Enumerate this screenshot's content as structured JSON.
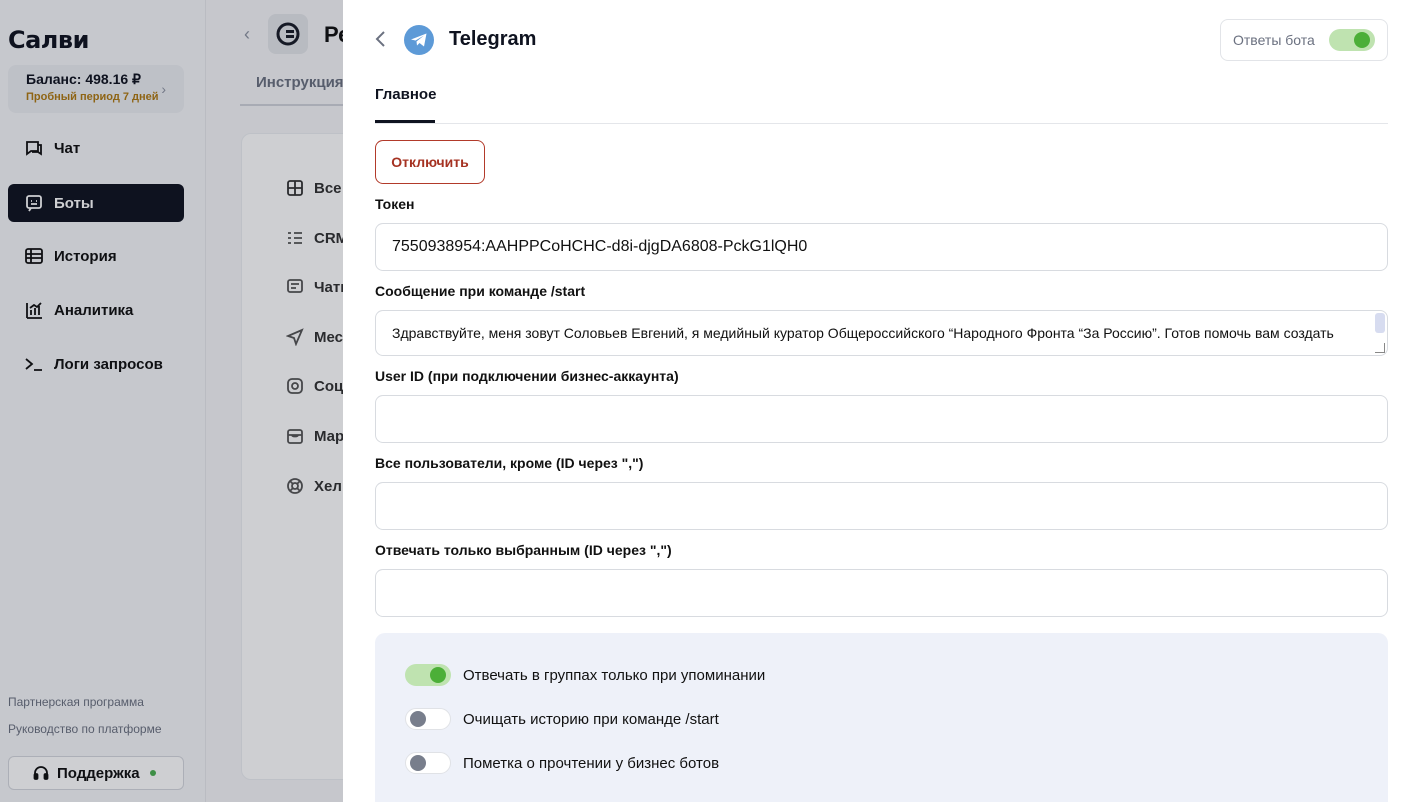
{
  "sidebar": {
    "logo": "Салви",
    "balance": {
      "amount": "Баланс: 498.16 ₽",
      "trial": "Пробный период 7 дней"
    },
    "nav": [
      {
        "label": "Чат",
        "icon": "chat-icon"
      },
      {
        "label": "Боты",
        "icon": "bot-icon",
        "active": true
      },
      {
        "label": "История",
        "icon": "history-icon"
      },
      {
        "label": "Аналитика",
        "icon": "analytics-icon"
      },
      {
        "label": "Логи запросов",
        "icon": "terminal-icon"
      }
    ],
    "footer_links": [
      "Партнерская программа",
      "Руководство по платформе"
    ],
    "support": "Поддержка"
  },
  "middle": {
    "title": "Ре",
    "tab": "Инструкция",
    "items": [
      "Все",
      "CRM",
      "Чаты",
      "Мес",
      "Соц",
      "Мар",
      "Хел"
    ]
  },
  "panel": {
    "title": "Telegram",
    "bot_answers_label": "Ответы бота",
    "bot_answers_on": true,
    "tab_main": "Главное",
    "disconnect": "Отключить",
    "fields": {
      "token_label": "Токен",
      "token_value": "7550938954:AAHPPCoHCHC-d8i-djgDA6808-PckG1lQH0",
      "start_label": "Сообщение при команде /start",
      "start_value": "Здравствуйте, меня зовут Соловьев Евгений, я медийный куратор Общероссийского “Народного Фронта “За Россию”. Готов помочь вам создать",
      "userid_label": "User ID (при подключении бизнес-аккаунта)",
      "userid_value": "",
      "except_label": "Все пользователи, кроме (ID через \",\")",
      "except_value": "",
      "only_label": "Отвечать только выбранным (ID через \",\")",
      "only_value": ""
    },
    "toggles": [
      {
        "label": "Отвечать в группах только при упоминании",
        "on": true
      },
      {
        "label": "Очищать историю при команде /start",
        "on": false
      },
      {
        "label": "Пометка о прочтении у бизнес ботов",
        "on": false
      }
    ]
  },
  "colors": {
    "accent": "#0f1320",
    "toggle_on": "#4caf38",
    "danger": "#a53222",
    "trial": "#b07a12"
  }
}
